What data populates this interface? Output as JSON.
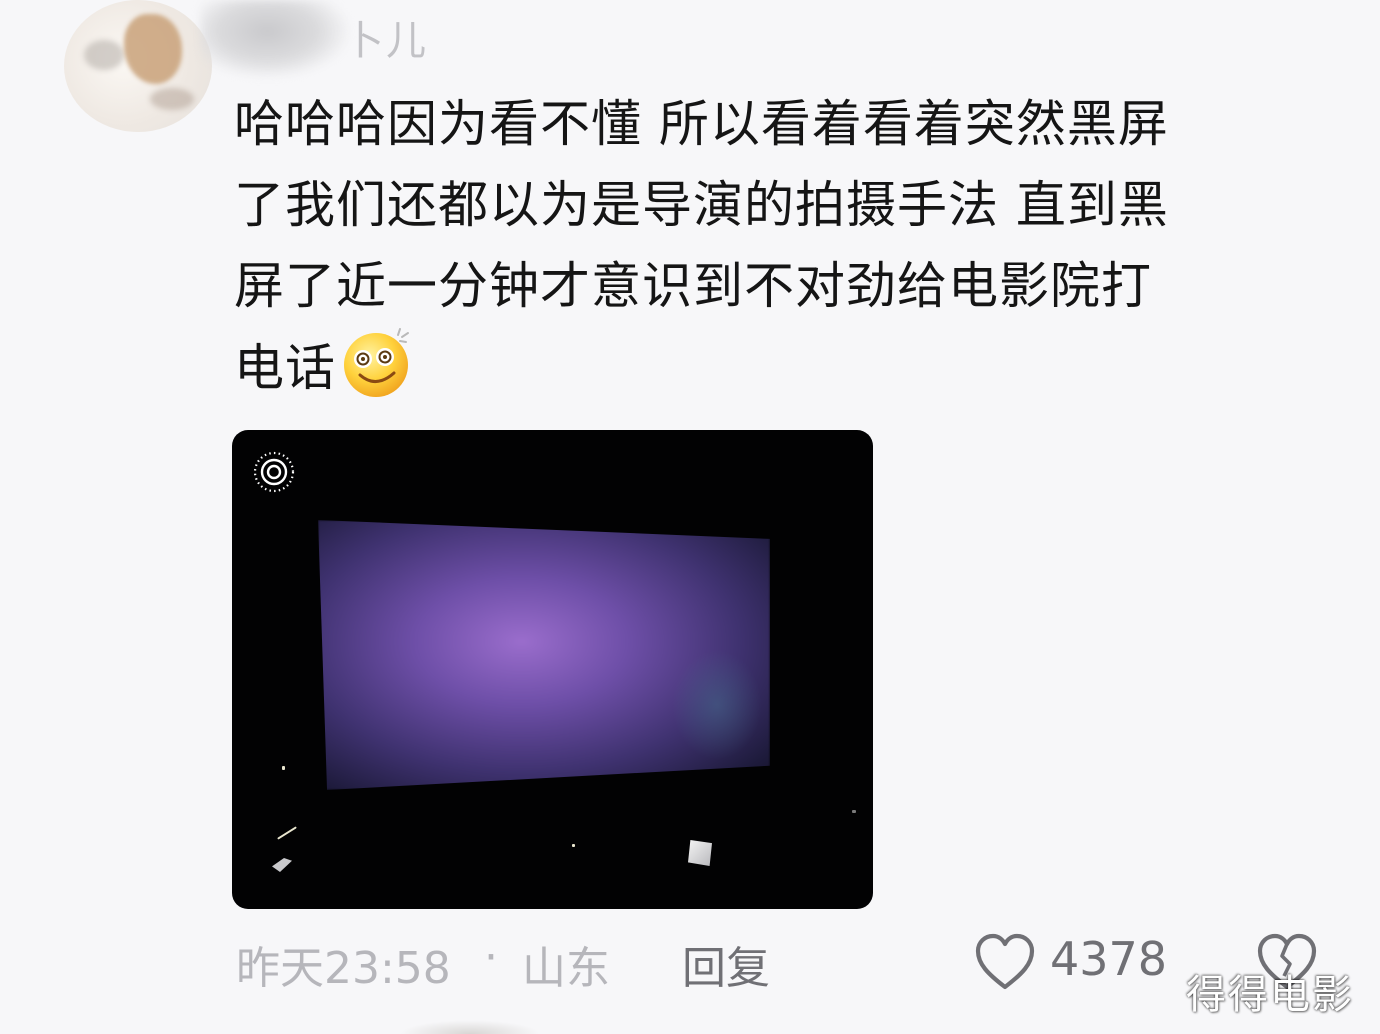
{
  "comment": {
    "username": "卜儿",
    "text_lines": [
      "哈哈哈因为看不懂 所以看着看着突然黑屏",
      "了我们还都以为是导演的拍摄手法 直到黑",
      "屏了近一分钟才意识到不对劲给电影院打",
      "电话"
    ],
    "emoji": "dizzy-smile-emoji",
    "timestamp": "昨天23:58",
    "separator": "·",
    "location": "山东",
    "reply_label": "回复",
    "like_count": "4378",
    "icons": {
      "like": "heart-outline-icon",
      "dislike": "broken-heart-icon",
      "live_photo": "live-photo-icon"
    }
  },
  "watermark": "得得电影",
  "colors": {
    "text": "#151515",
    "meta": "#b6b6bb",
    "action": "#707075",
    "background": "#f7f7f9",
    "photo_background": "#020203",
    "screen_glow": "#9a6dcc"
  }
}
